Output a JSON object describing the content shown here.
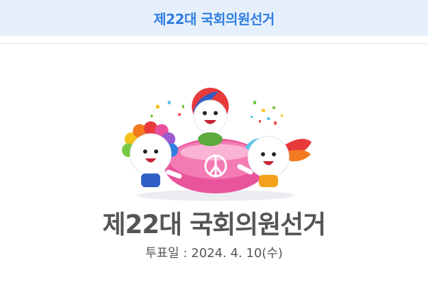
{
  "banner": {
    "title": "제22대 국회의원선거"
  },
  "main": {
    "title": "제22대 국회의원선거",
    "date_text": "투표일 : 2024. 4. 10(수)"
  },
  "illustration": {
    "icon": "election-mascots-ballot-icon",
    "ballot_mark": "☯"
  },
  "colors": {
    "banner_bg": "#e6f0fc",
    "banner_text": "#2f7ee0",
    "title_text": "#555555",
    "ballot_pink": "#e9559b"
  }
}
